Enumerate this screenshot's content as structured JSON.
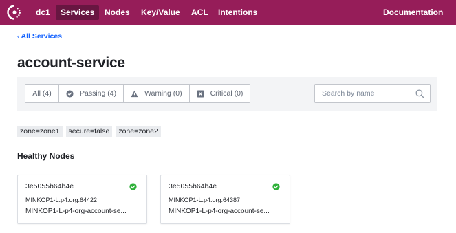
{
  "nav": {
    "datacenter": "dc1",
    "items": [
      {
        "label": "Services",
        "active": true
      },
      {
        "label": "Nodes",
        "active": false
      },
      {
        "label": "Key/Value",
        "active": false
      },
      {
        "label": "ACL",
        "active": false
      },
      {
        "label": "Intentions",
        "active": false
      }
    ],
    "documentation": "Documentation",
    "color": "#961d59",
    "active_color": "#681641"
  },
  "breadcrumb": {
    "label": "All Services"
  },
  "page": {
    "title": "account-service"
  },
  "filters": {
    "tabs": [
      {
        "label": "All (4)",
        "icon": null,
        "active": true
      },
      {
        "label": "Passing (4)",
        "icon": "check-circle-icon",
        "active": false
      },
      {
        "label": "Warning (0)",
        "icon": "warning-triangle-icon",
        "active": false
      },
      {
        "label": "Critical (0)",
        "icon": "critical-x-icon",
        "active": false
      }
    ],
    "search": {
      "placeholder": "Search by name",
      "value": "",
      "icon": "search-icon"
    }
  },
  "tags": [
    "zone=zone1",
    "secure=false",
    "zone=zone2"
  ],
  "section": {
    "title": "Healthy Nodes"
  },
  "nodes": [
    {
      "name": "3e5055b64b4e",
      "address": "MINKOP1-L.p4.org:64422",
      "service": "MINKOP1-L-p4-org-account-se...",
      "status_icon": "passing-check-icon",
      "status_color": "#2eb039"
    },
    {
      "name": "3e5055b64b4e",
      "address": "MINKOP1-L.p4.org:64387",
      "service": "MINKOP1-L-p4-org-account-se...",
      "status_icon": "passing-check-icon",
      "status_color": "#2eb039"
    }
  ]
}
